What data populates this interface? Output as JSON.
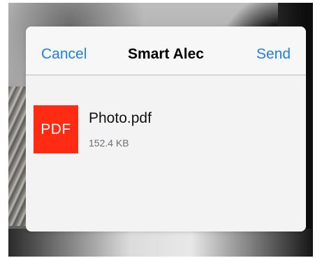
{
  "nav": {
    "cancel_label": "Cancel",
    "title": "Smart Alec",
    "send_label": "Send"
  },
  "attachment": {
    "thumb_label": "PDF",
    "file_name": "Photo.pdf",
    "file_size": "152.4 KB",
    "icon": "pdf-file-icon"
  },
  "colors": {
    "accent": "#1d7ff0",
    "pdf_red": "#ff2b12",
    "sheet_bg": "#f7f7f7"
  }
}
